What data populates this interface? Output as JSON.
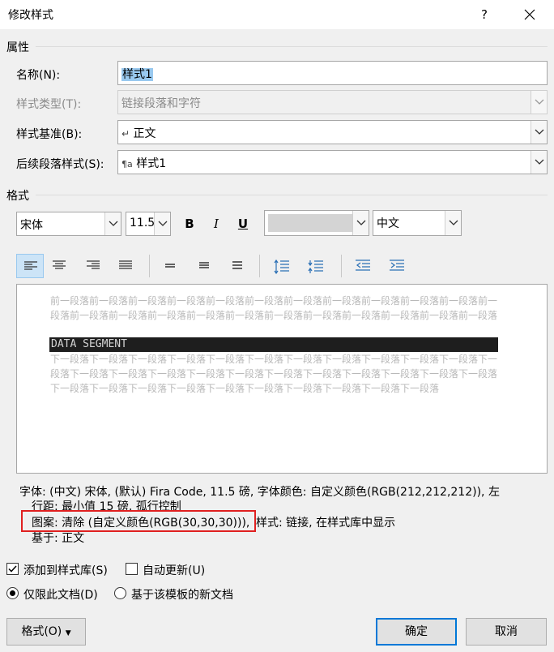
{
  "window": {
    "title": "修改样式",
    "help": "?"
  },
  "properties": {
    "section": "属性",
    "name_label": "名称(N):",
    "name_value": "样式1",
    "type_label": "样式类型(T):",
    "type_value": "链接段落和字符",
    "base_label": "样式基准(B):",
    "base_value": "正文",
    "next_label": "后续段落样式(S):",
    "next_value": "样式1"
  },
  "format": {
    "section": "格式",
    "font": "宋体",
    "size": "11.5",
    "bold": "B",
    "italic": "I",
    "underline": "U",
    "script": "中文"
  },
  "preview": {
    "prev_paragraph": "前一段落前一段落前一段落前一段落前一段落前一段落前一段落前一段落前一段落前一段落前一段落前一段落前一段落前一段落前一段落前一段落前一段落前一段落前一段落前一段落前一段落前一段落前一段落",
    "segment": "DATA SEGMENT",
    "next_paragraph": "下一段落下一段落下一段落下一段落下一段落下一段落下一段落下一段落下一段落下一段落下一段落下一段落下一段落下一段落下一段落下一段落下一段落下一段落下一段落下一段落下一段落下一段落下一段落下一段落下一段落下一段落下一段落下一段落下一段落下一段落下一段落下一段落下一段落"
  },
  "description": {
    "line1": "字体: (中文) 宋体, (默认) Fira Code, 11.5 磅, 字体颜色: 自定义颜色(RGB(212,212,212)), 左",
    "line2": "行距: 最小值 15 磅, 孤行控制",
    "line3a": "图案: 清除 (自定义颜色(RGB(30,30,30))),",
    "line3b": "样式: 链接, 在样式库中显示",
    "line4": "基于: 正文"
  },
  "options": {
    "add_to_gallery": "添加到样式库(S)",
    "auto_update": "自动更新(U)",
    "this_doc": "仅限此文档(D)",
    "new_docs": "基于该模板的新文档"
  },
  "buttons": {
    "format": "格式(O)",
    "ok": "确定",
    "cancel": "取消"
  }
}
